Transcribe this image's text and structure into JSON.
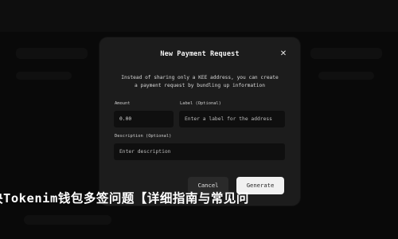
{
  "modal": {
    "title": "New Payment Request",
    "description_line1": "Instead of sharing only a KEE address, you can create",
    "description_line2": "a payment request by bundling up information",
    "amount_label": "Amount",
    "amount_value": "0.00",
    "label_label": "Label (Optional)",
    "label_placeholder": "Enter a label for the address",
    "description_label": "Description (Optional)",
    "description_placeholder": "Enter description",
    "cancel_label": "Cancel",
    "generate_label": "Generate",
    "close_icon": "close-icon"
  },
  "caption": "决Tokenim钱包多签问题【详细指南与常见问"
}
